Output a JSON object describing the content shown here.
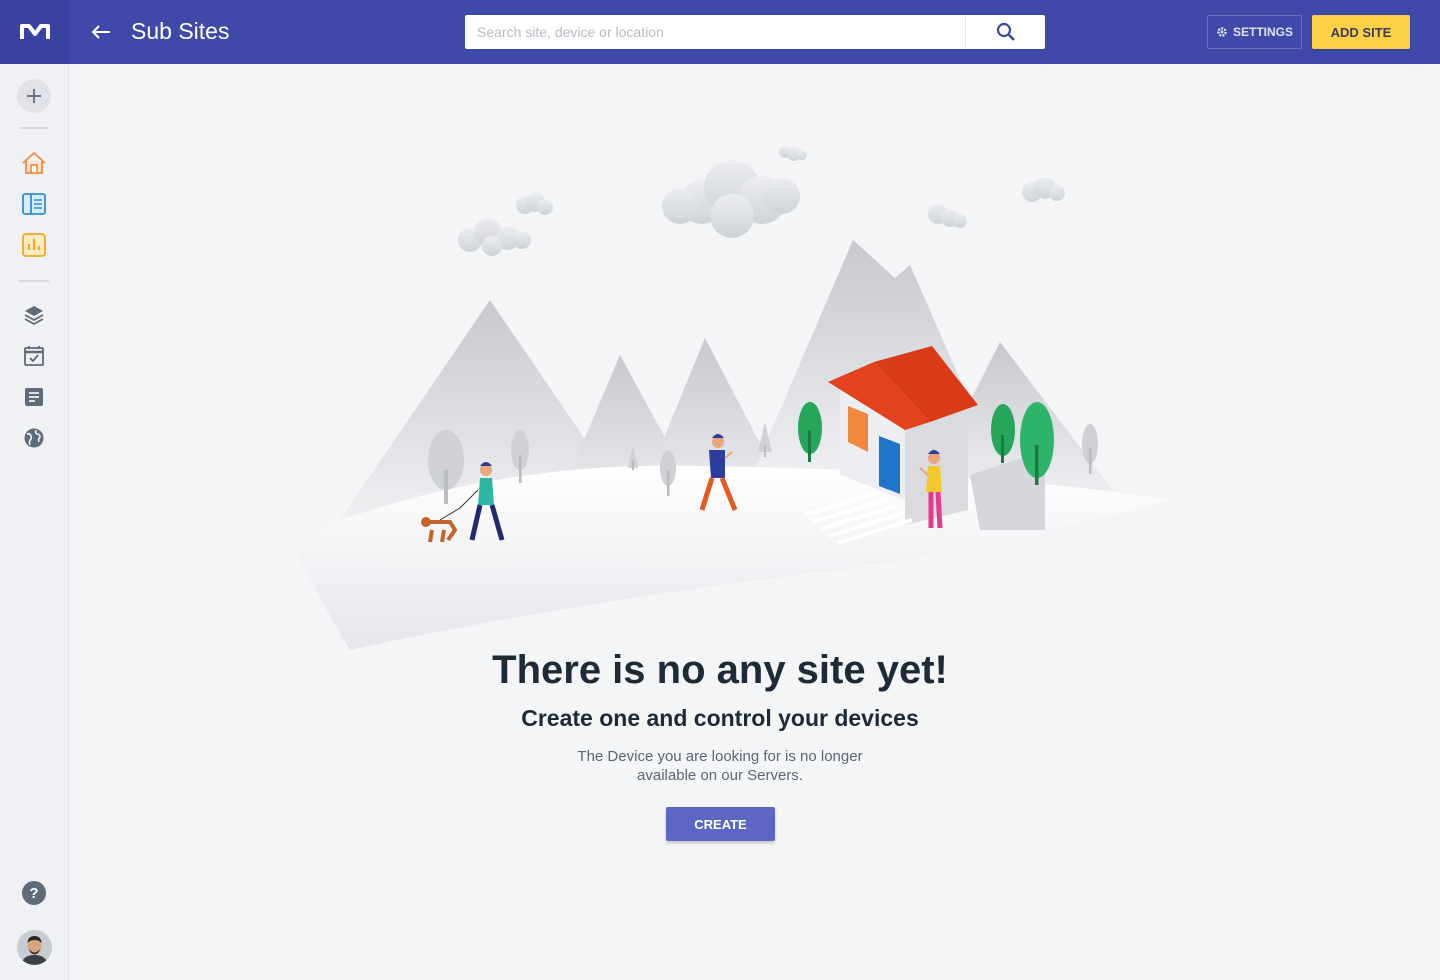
{
  "header": {
    "title": "Sub Sites",
    "search_placeholder": "Search site, device or location",
    "settings_label": "SETTINGS",
    "add_site_label": "ADD SITE"
  },
  "sidebar": {
    "items": [
      {
        "icon": "home-icon",
        "color": "#f0893c"
      },
      {
        "icon": "dashboard-icon",
        "color": "#2f8fd6"
      },
      {
        "icon": "chart-icon",
        "color": "#f5a623"
      },
      {
        "icon": "layers-icon",
        "color": "#5f6b78"
      },
      {
        "icon": "calendar-check-icon",
        "color": "#5f6b78"
      },
      {
        "icon": "notes-icon",
        "color": "#5f6b78"
      },
      {
        "icon": "globe-icon",
        "color": "#5f6b78"
      }
    ],
    "help_label": "?"
  },
  "empty_state": {
    "title": "There is no any site yet!",
    "subtitle": "Create one and control your devices",
    "description": "The Device you are looking for is no longer available on our Servers.",
    "create_label": "CREATE"
  },
  "colors": {
    "header": "#3f49a8",
    "accent_yellow": "#fdd048",
    "primary_button": "#5c67c4"
  }
}
